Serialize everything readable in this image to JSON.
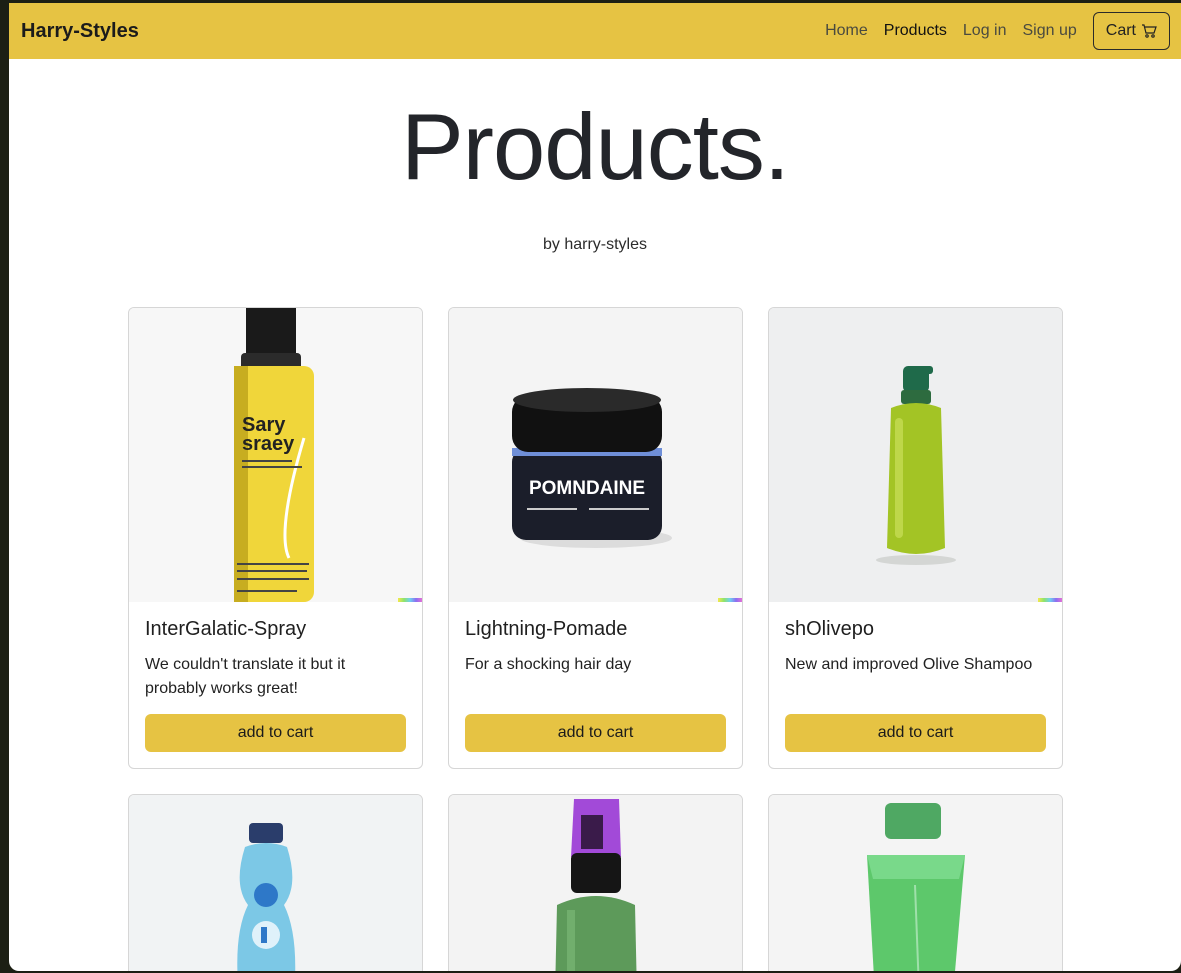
{
  "navbar": {
    "brand": "Harry-Styles",
    "links": [
      "Home",
      "Products",
      "Log in",
      "Sign up"
    ],
    "cart_label": "Cart"
  },
  "hero": {
    "title": "Products.",
    "byline": "by harry-styles"
  },
  "products": [
    {
      "name": "InterGalatic-Spray",
      "description": "We couldn't translate it but it probably works great!",
      "button": "add to cart",
      "image_label_1": "Sary",
      "image_label_2": "sraey"
    },
    {
      "name": "Lightning-Pomade",
      "description": "For a shocking hair day",
      "button": "add to cart",
      "image_label_1": "POMNDAINE"
    },
    {
      "name": "shOlivepo",
      "description": "New and improved Olive Shampoo",
      "button": "add to cart"
    }
  ],
  "colors": {
    "accent": "#e6c343",
    "text": "#23252a"
  }
}
